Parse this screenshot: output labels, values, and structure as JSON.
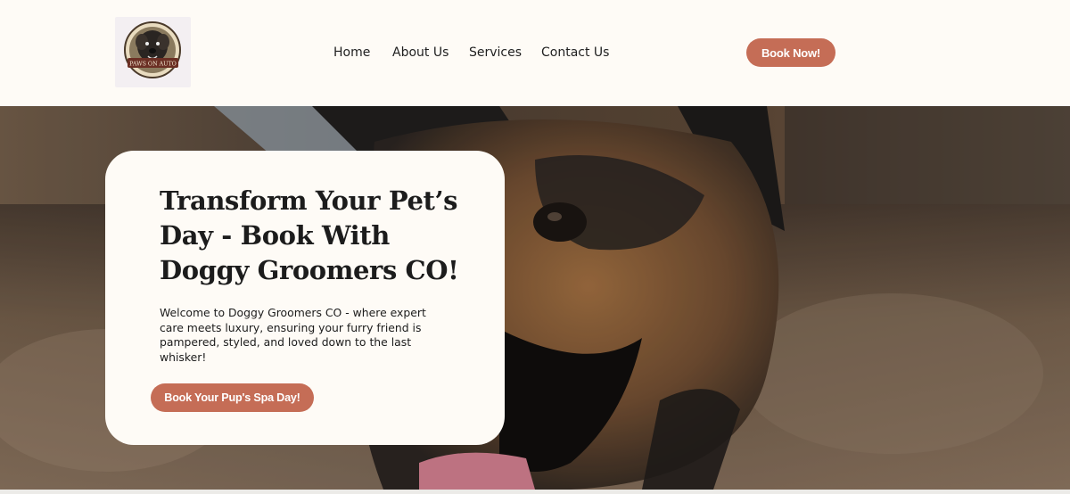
{
  "brand": {
    "logo_text": "PAWS ON AUTO"
  },
  "nav": {
    "items": [
      {
        "label": "Home"
      },
      {
        "label": "About Us"
      },
      {
        "label": "Services"
      },
      {
        "label": "Contact Us"
      }
    ]
  },
  "header": {
    "book_now_label": "Book Now!"
  },
  "hero": {
    "title": "Transform Your Pet’s Day - Book With Doggy Groomers CO!",
    "description": "Welcome to Doggy Groomers CO - where expert care meets luxury, ensuring your furry friend is pampered, styled, and loved down to the last whisker!",
    "cta_label": "Book Your Pup's Spa Day!"
  },
  "colors": {
    "accent": "#c56d56",
    "background": "#fefbf6",
    "text": "#1c1c1c"
  },
  "icons": {
    "logo": "dog-badge-logo"
  }
}
